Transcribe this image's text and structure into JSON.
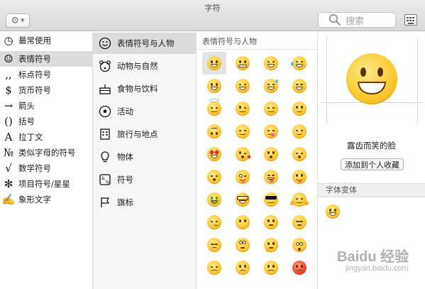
{
  "window": {
    "title": "字符"
  },
  "toolbar": {
    "search_placeholder": "搜索"
  },
  "categories": [
    {
      "icon": "clock-icon",
      "glyph": "◷",
      "label": "最常使用"
    },
    {
      "icon": "smiley-icon",
      "glyph": "☺",
      "label": "表情符号",
      "selected": true
    },
    {
      "icon": "punctuation-icon",
      "glyph": ",,",
      "label": "标点符号"
    },
    {
      "icon": "dollar-icon",
      "glyph": "$",
      "label": "货币符号"
    },
    {
      "icon": "arrow-icon",
      "glyph": "→",
      "label": "箭头"
    },
    {
      "icon": "parentheses-icon",
      "glyph": "()",
      "label": "括号"
    },
    {
      "icon": "latin-a-icon",
      "glyph": "A",
      "label": "拉丁文"
    },
    {
      "icon": "numero-icon",
      "glyph": "№",
      "label": "类似字母的符号"
    },
    {
      "icon": "sqrt-icon",
      "glyph": "√",
      "label": "数学符号"
    },
    {
      "icon": "asterisk-icon",
      "glyph": "✻",
      "label": "项目符号/星星"
    },
    {
      "icon": "pictograph-icon",
      "glyph": "✍",
      "label": "象形文字"
    }
  ],
  "subcategories": [
    {
      "icon": "smiley-icon",
      "label": "表情符号与人物",
      "selected": true
    },
    {
      "icon": "bear-icon",
      "label": "动物与自然"
    },
    {
      "icon": "cake-icon",
      "label": "食物与饮料"
    },
    {
      "icon": "soccer-ball-icon",
      "label": "活动"
    },
    {
      "icon": "building-icon",
      "label": "旅行与地点"
    },
    {
      "icon": "lightbulb-icon",
      "label": "物体"
    },
    {
      "icon": "symbols-icon",
      "label": "符号"
    },
    {
      "icon": "flag-icon",
      "label": "旗标"
    }
  ],
  "grid": {
    "title": "表情符号与人物",
    "rows": [
      [
        "grinning",
        "grimacing",
        "grin",
        "joy"
      ],
      [
        "smiley",
        "smile",
        "sweat-smile",
        "laughing"
      ],
      [
        "innocent",
        "wink",
        "blush",
        "slight-smile"
      ],
      [
        "upside-down",
        "relaxed",
        "yum",
        "relieved"
      ],
      [
        "heart-eyes",
        "kissing-heart",
        "kissing",
        "kissing-smiling"
      ],
      [
        "kissing-closed-eyes",
        "tongue-wink",
        "tongue-closed-eyes",
        "tongue"
      ],
      [
        "money-mouth",
        "nerd",
        "sunglasses",
        "hugging"
      ],
      [
        "smirk",
        "no-mouth",
        "neutral",
        "expressionless"
      ],
      [
        "unamused",
        "rolling-eyes",
        "thinking",
        "flushed"
      ],
      [
        "disappointed",
        "worried",
        "angry",
        "rage"
      ]
    ]
  },
  "detail": {
    "name": "露齿而笑的脸",
    "add_favorites": "添加到个人收藏",
    "variants_header": "字体变体"
  },
  "watermark": {
    "line1": "Baidu 经验",
    "line2": "jingyan.baidu.com"
  },
  "colors": {
    "selection": "#dcdcdc",
    "emoji_yellow": "#ffcc33",
    "rage_red": "#f2452b"
  }
}
